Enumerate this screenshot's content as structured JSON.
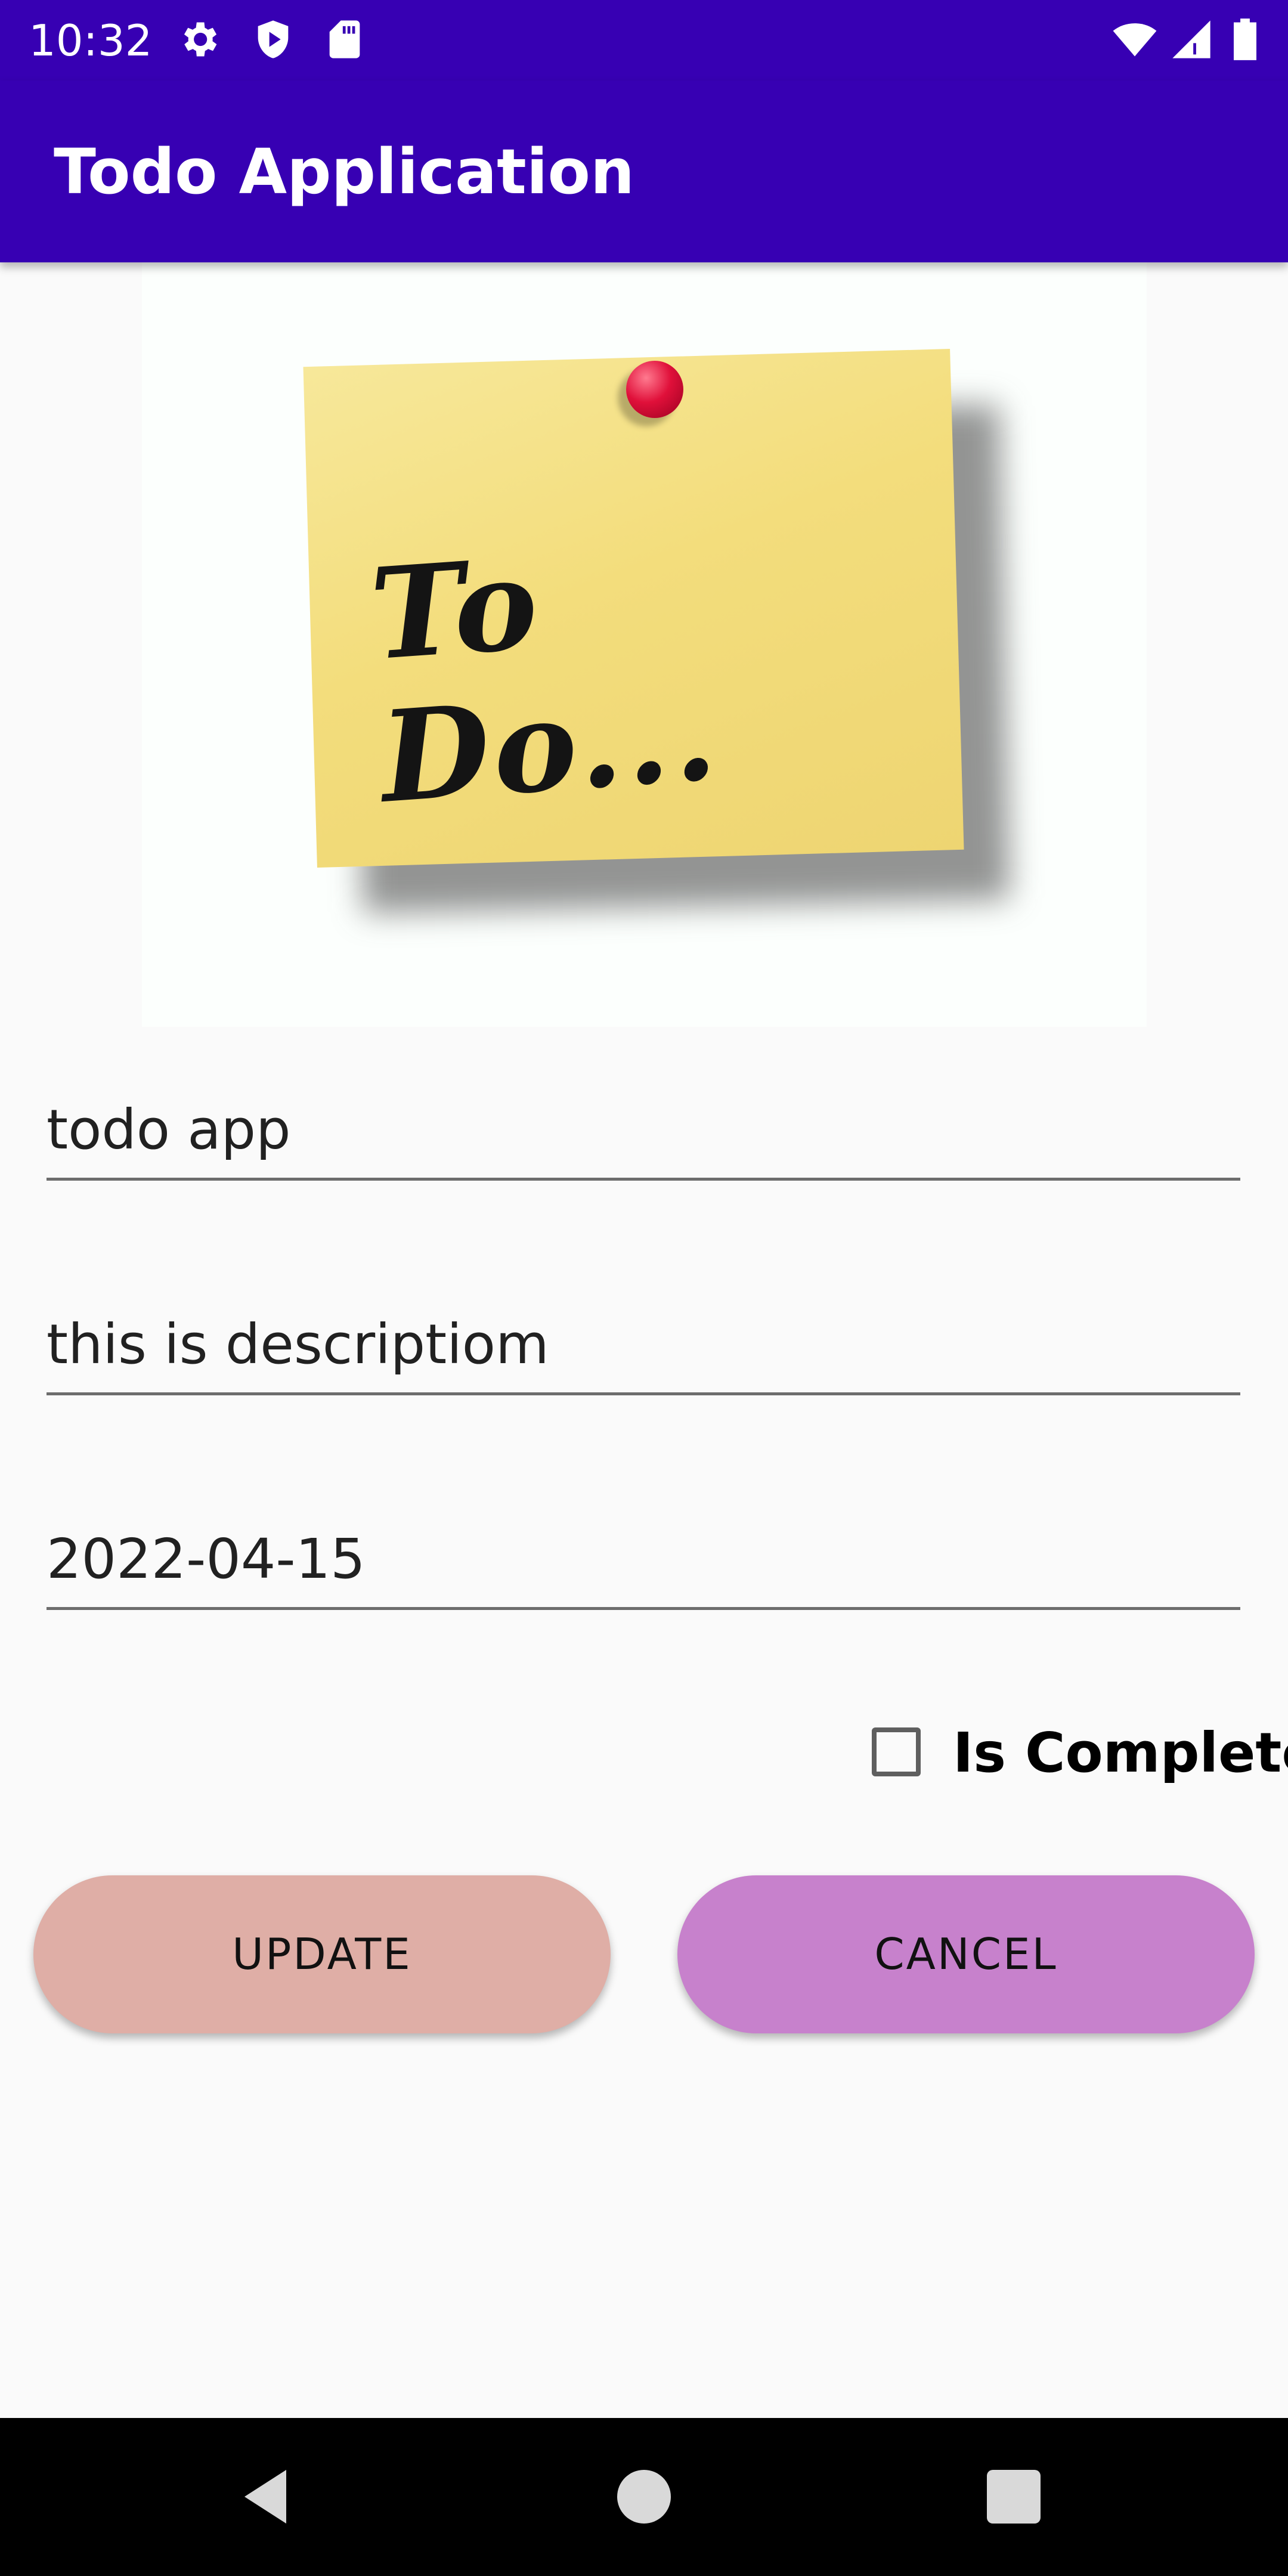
{
  "status_bar": {
    "time": "10:32",
    "left_icons": [
      "gear-icon",
      "shield-play-icon",
      "sd-card-icon"
    ],
    "right_icons": [
      "wifi-icon",
      "cell-signal-icon",
      "battery-icon"
    ]
  },
  "app_bar": {
    "title": "Todo Application",
    "color": "#3700b3"
  },
  "hero_image": {
    "text": "To Do...",
    "description": "sticky-note-image"
  },
  "form": {
    "title_value": "todo app",
    "description_value": "this is descriptiom",
    "date_value": "2022-04-15",
    "complete_label": "Is Complete",
    "complete_checked": false
  },
  "buttons": {
    "update_label": "UPDATE",
    "update_color": "#dfaea6",
    "cancel_label": "CANCEL",
    "cancel_color": "#c781cc"
  },
  "nav_bar": {
    "icons": [
      "back-icon",
      "home-icon",
      "recents-icon"
    ]
  }
}
